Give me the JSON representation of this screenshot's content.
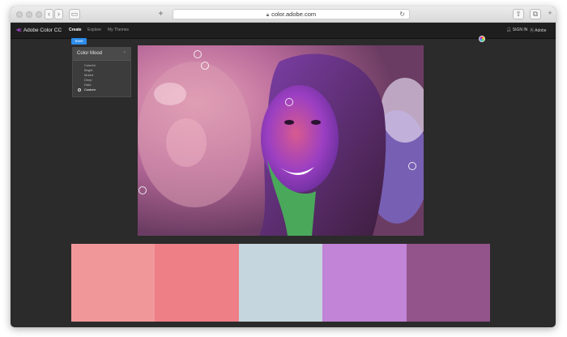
{
  "browser": {
    "url": "color.adobe.com"
  },
  "app": {
    "logo_text": "Adobe Color CC",
    "nav": [
      {
        "label": "Create"
      },
      {
        "label": "Explore"
      },
      {
        "label": "My Themes"
      }
    ],
    "sign_in": "SIGN IN",
    "adobe": "Adobe"
  },
  "toolbar": {
    "save_label": "Save"
  },
  "mood_panel": {
    "title": "Color Mood",
    "options": [
      {
        "label": "Colorful"
      },
      {
        "label": "Bright"
      },
      {
        "label": "Muted"
      },
      {
        "label": "Deep"
      },
      {
        "label": "Dark"
      },
      {
        "label": "Custom"
      }
    ],
    "selected": "Custom"
  },
  "swatches": [
    {
      "color": "#f0979a"
    },
    {
      "color": "#ee7f87"
    },
    {
      "color": "#c6d6de"
    },
    {
      "color": "#c184d6"
    },
    {
      "color": "#93548b"
    }
  ],
  "icons": {
    "back": "chevron-left-icon",
    "forward": "chevron-right-icon",
    "sidebar": "sidebar-icon",
    "lock": "lock-icon",
    "reload": "reload-icon",
    "share": "share-icon",
    "tabs": "tabs-icon",
    "new_tab": "plus-icon",
    "color_wheel": "color-wheel-icon",
    "user": "user-icon"
  }
}
